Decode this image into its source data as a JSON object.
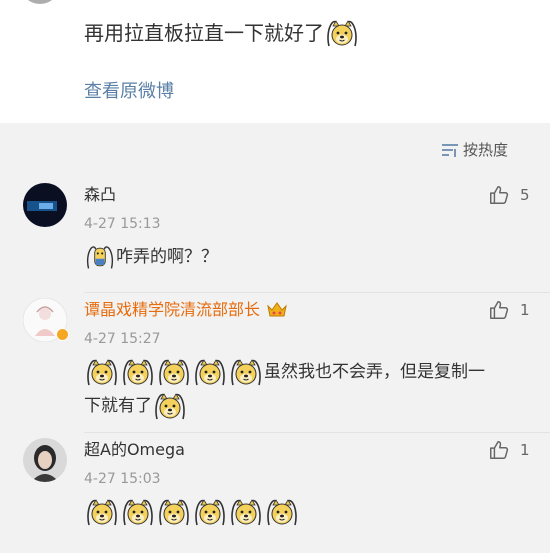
{
  "post": {
    "text": "再用拉直板拉直一下就好了",
    "view_original": "查看原微博"
  },
  "sort": {
    "label": "按热度"
  },
  "comments": [
    {
      "name": "森凸",
      "time": "4-27 15:13",
      "likes": "5",
      "text": "咋弄的啊？？"
    },
    {
      "name": "谭晶戏精学院清流部部长",
      "time": "4-27 15:27",
      "likes": "1",
      "text_line1": "虽然我也不会弄，但是复制一",
      "text_line2": "下就有了"
    },
    {
      "name": "超A的Omega",
      "time": "4-27 15:03",
      "likes": "1"
    }
  ],
  "icons": {
    "like": "thumbs-up-icon",
    "sort": "sort-lines-icon",
    "emoji": "doge-emoji-icon",
    "crown": "crown-badge-icon"
  },
  "colors": {
    "link": "#5b7fa6",
    "vip_name": "#e86b0c",
    "meta": "#999999",
    "background": "#f2f2f2"
  }
}
